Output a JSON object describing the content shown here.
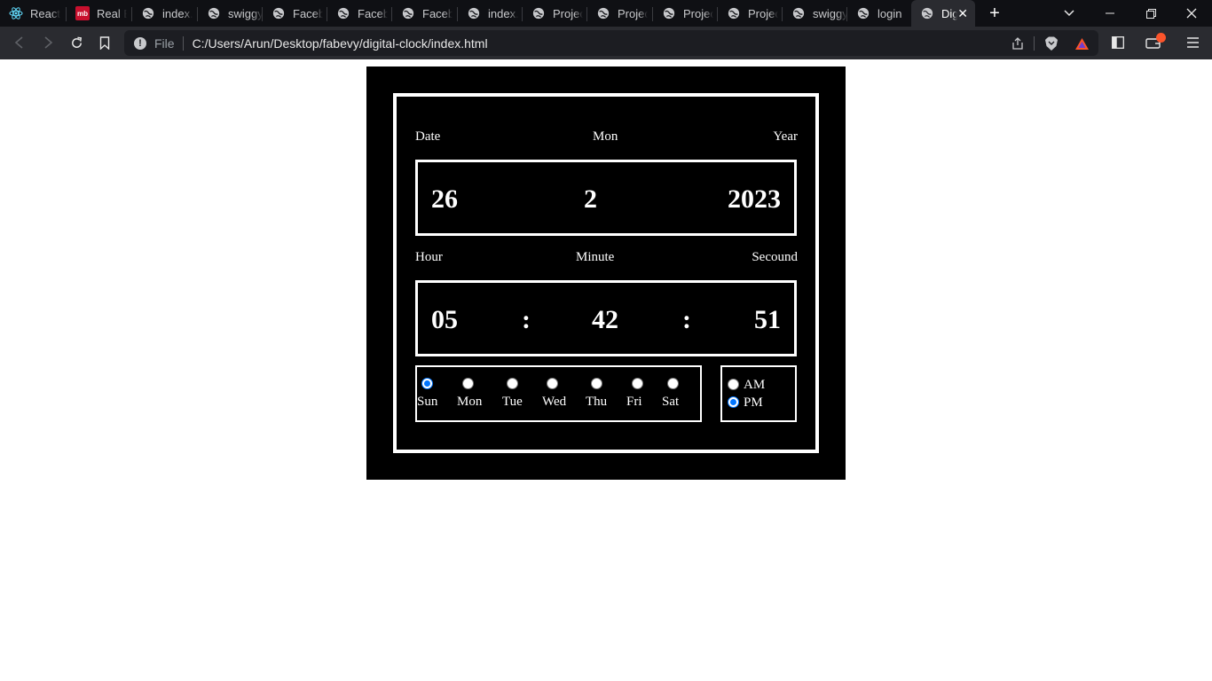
{
  "browser": {
    "tabs": [
      {
        "label": "React A",
        "icon": "react-icon"
      },
      {
        "label": "Real Es",
        "icon": "magicbricks-icon"
      },
      {
        "label": "index.h",
        "icon": "globe-icon"
      },
      {
        "label": "swiggy",
        "icon": "globe-icon"
      },
      {
        "label": "Facebo",
        "icon": "globe-icon"
      },
      {
        "label": "Facebo",
        "icon": "globe-icon"
      },
      {
        "label": "Facebo",
        "icon": "globe-icon"
      },
      {
        "label": "index.h",
        "icon": "globe-icon"
      },
      {
        "label": "Project",
        "icon": "globe-icon"
      },
      {
        "label": "Project",
        "icon": "globe-icon"
      },
      {
        "label": "Project",
        "icon": "globe-icon"
      },
      {
        "label": "Project",
        "icon": "globe-icon"
      },
      {
        "label": "swiggy",
        "icon": "globe-icon"
      },
      {
        "label": "login",
        "icon": "globe-icon"
      },
      {
        "label": "Dig",
        "icon": "globe-icon",
        "active": true
      }
    ],
    "mb_icon_text": "mb",
    "address": {
      "scheme_label": "File",
      "url": "C:/Users/Arun/Desktop/fabevy/digital-clock/index.html"
    },
    "colors": {
      "tab_strip": "#0f1014",
      "toolbar": "#2a2b30",
      "omnibox": "#1c1d22",
      "brave_orange": "#fb542b"
    }
  },
  "clock": {
    "date_labels": {
      "date": "Date",
      "month": "Mon",
      "year": "Year"
    },
    "date_values": {
      "date": "26",
      "month": "2",
      "year": "2023"
    },
    "time_labels": {
      "hour": "Hour",
      "minute": "Minute",
      "second": "Secound"
    },
    "time_values": {
      "hour": "05",
      "sep1": ":",
      "minute": "42",
      "sep2": ":",
      "second": "51"
    },
    "days": [
      {
        "label": "Sun",
        "checked": true
      },
      {
        "label": "Mon",
        "checked": false
      },
      {
        "label": "Tue",
        "checked": false
      },
      {
        "label": "Wed",
        "checked": false
      },
      {
        "label": "Thu",
        "checked": false
      },
      {
        "label": "Fri",
        "checked": false
      },
      {
        "label": "Sat",
        "checked": false
      }
    ],
    "meridiem": [
      {
        "label": "AM",
        "checked": false
      },
      {
        "label": "PM",
        "checked": true
      }
    ],
    "colors": {
      "background": "#000000",
      "foreground": "#ffffff",
      "radio_checked": "#0075ff"
    }
  }
}
